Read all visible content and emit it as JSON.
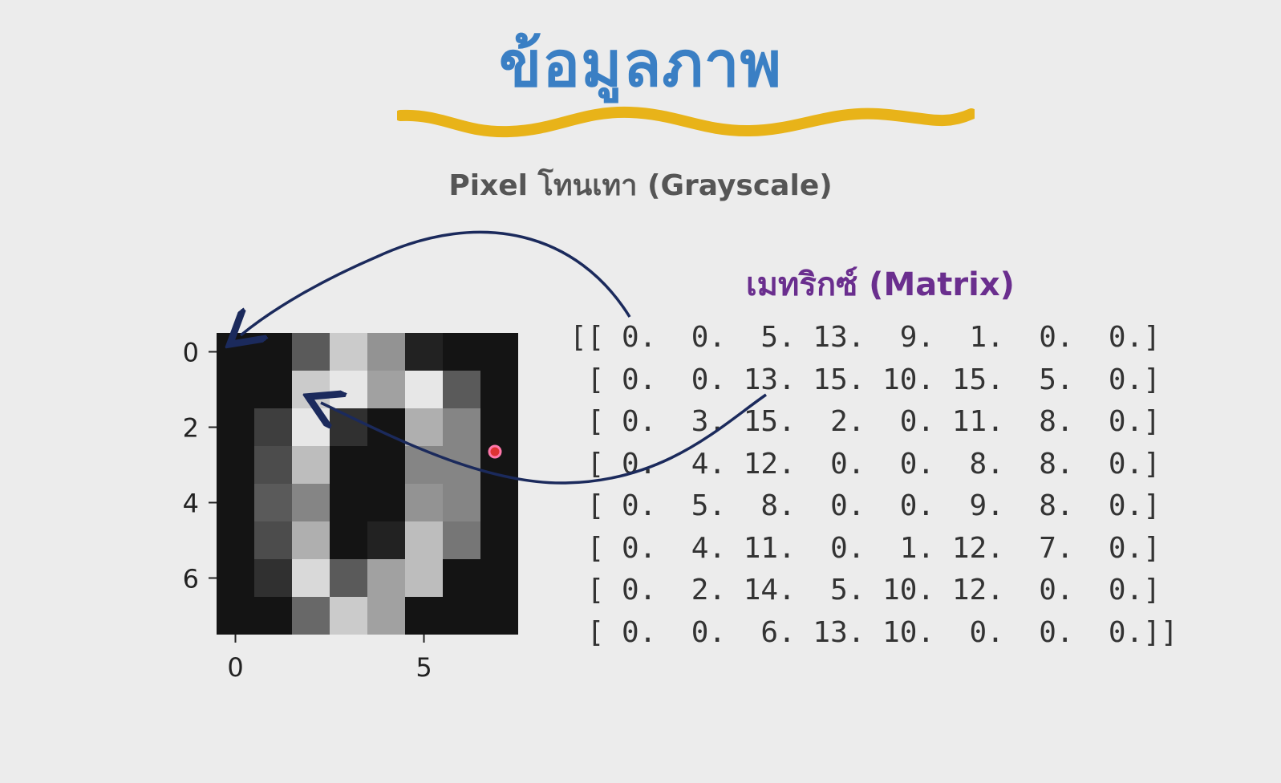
{
  "title": "ข้อมูลภาพ",
  "subtitle": "Pixel โทนเทา (Grayscale)",
  "matrix_label": "เมทริกซ์ (Matrix)",
  "colors": {
    "title": "#3a7fc4",
    "wave": "#e8b319",
    "matrix_label": "#6a2e8e",
    "arrow": "#1b2a5c"
  },
  "image": {
    "pixels": [
      [
        0,
        0,
        5,
        13,
        9,
        1,
        0,
        0
      ],
      [
        0,
        0,
        13,
        15,
        10,
        15,
        5,
        0
      ],
      [
        0,
        3,
        15,
        2,
        0,
        11,
        8,
        0
      ],
      [
        0,
        4,
        12,
        0,
        0,
        8,
        8,
        0
      ],
      [
        0,
        5,
        8,
        0,
        0,
        9,
        8,
        0
      ],
      [
        0,
        4,
        11,
        0,
        1,
        12,
        7,
        0
      ],
      [
        0,
        2,
        14,
        5,
        10,
        12,
        0,
        0
      ],
      [
        0,
        0,
        6,
        13,
        10,
        0,
        0,
        0
      ]
    ],
    "y_ticks": [
      "0",
      "2",
      "4",
      "6"
    ],
    "x_ticks": [
      "0",
      "5"
    ]
  },
  "matrix_lines": [
    "[[ 0.  0.  5. 13.  9.  1.  0.  0.]",
    " [ 0.  0. 13. 15. 10. 15.  5.  0.]",
    " [ 0.  3. 15.  2.  0. 11.  8.  0.]",
    " [ 0.  4. 12.  0.  0.  8.  8.  0.]",
    " [ 0.  5.  8.  0.  0.  9.  8.  0.]",
    " [ 0.  4. 11.  0.  1. 12.  7.  0.]",
    " [ 0.  2. 14.  5. 10. 12.  0.  0.]",
    " [ 0.  0.  6. 13. 10.  0.  0.  0.]]"
  ]
}
